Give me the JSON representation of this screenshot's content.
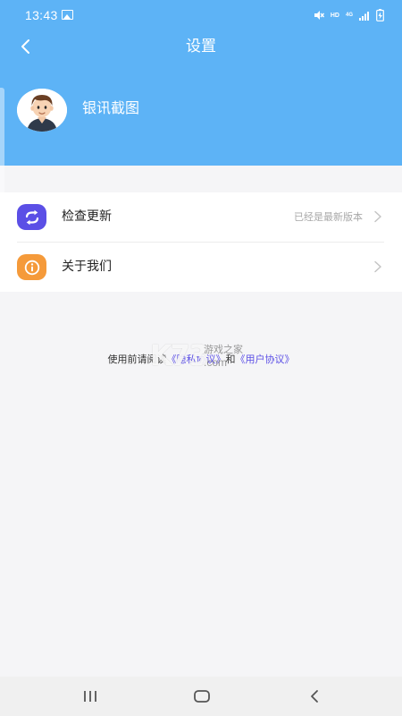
{
  "status_bar": {
    "time": "13:43",
    "network_label": "HD",
    "network_type": "4G"
  },
  "header": {
    "title": "设置",
    "username": "银讯截图",
    "background_color": "#5db3f6"
  },
  "menu": {
    "items": [
      {
        "label": "检查更新",
        "value": "已经是最新版本",
        "icon": "refresh-icon",
        "icon_color": "#5b4fe6"
      },
      {
        "label": "关于我们",
        "value": "",
        "icon": "info-icon",
        "icon_color": "#f59a3a"
      }
    ]
  },
  "agreement": {
    "prefix": "使用前请阅读",
    "privacy_link": "《隐私协议》",
    "connector": "和",
    "user_link": "《用户协议》"
  },
  "watermark": {
    "logo": "K73",
    "text_cn": "游戏之家",
    "text_com": ".com"
  },
  "nav_bar": {
    "icons": [
      "recent-apps-icon",
      "home-icon",
      "back-icon"
    ]
  }
}
